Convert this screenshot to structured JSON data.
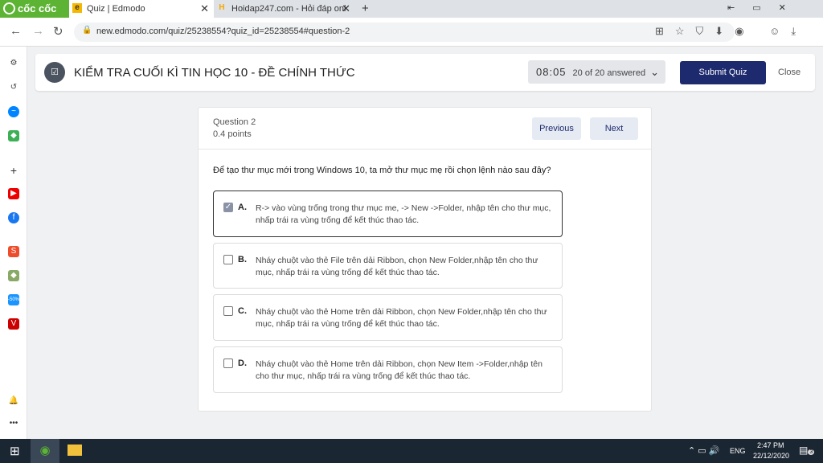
{
  "browser": {
    "brand": "cốc cốc",
    "tabs": [
      {
        "title": "Quiz | Edmodo",
        "icon": "edmodo-icon"
      },
      {
        "title": "Hoidap247.com - Hỏi đáp onl",
        "icon": "hoidap-icon"
      }
    ],
    "new_tab": "+",
    "url": "new.edmodo.com/quiz/25238554?quiz_id=25238554#question-2"
  },
  "header": {
    "title": "KIỂM TRA CUỐI KÌ TIN HỌC 10 - ĐỀ CHÍNH THỨC",
    "timer": "08:05",
    "answered": "20 of 20 answered",
    "submit": "Submit Quiz",
    "close": "Close"
  },
  "question": {
    "label": "Question 2",
    "points": "0.4 points",
    "previous": "Previous",
    "next": "Next",
    "prompt": "Để tạo thư mục mới trong Windows 10, ta mở thư mục mẹ rồi chọn lệnh nào sau đây?",
    "options": [
      {
        "letter": "A.",
        "text": "R-> vào vùng trống trong thư mục me, -> New ->Folder, nhập tên cho thư mục, nhấp trái ra vùng trống để kết thúc thao tác.",
        "checked": true
      },
      {
        "letter": "B.",
        "text": "Nháy chuột vào thẻ File trên dải Ribbon, chọn New Folder,nhập tên cho thư mục, nhấp trái ra vùng trống để kết thúc thao tác.",
        "checked": false
      },
      {
        "letter": "C.",
        "text": "Nháy chuột vào thẻ Home trên dải Ribbon, chọn New Folder,nhập tên cho thư mục, nhấp trái ra vùng trống để kết thúc thao tác.",
        "checked": false
      },
      {
        "letter": "D.",
        "text": "Nháy chuột vào thẻ Home trên dải Ribbon, chọn New Item ->Folder,nhập tên cho thư mục, nhấp trái ra vùng trống để kết thúc thao tác.",
        "checked": false
      }
    ]
  },
  "taskbar": {
    "lang": "ENG",
    "time": "2:47 PM",
    "date": "22/12/2020",
    "notifications": "3"
  },
  "colors": {
    "brand_green": "#5cb334",
    "submit": "#1e2a6e",
    "taskbar": "#1b2633"
  }
}
